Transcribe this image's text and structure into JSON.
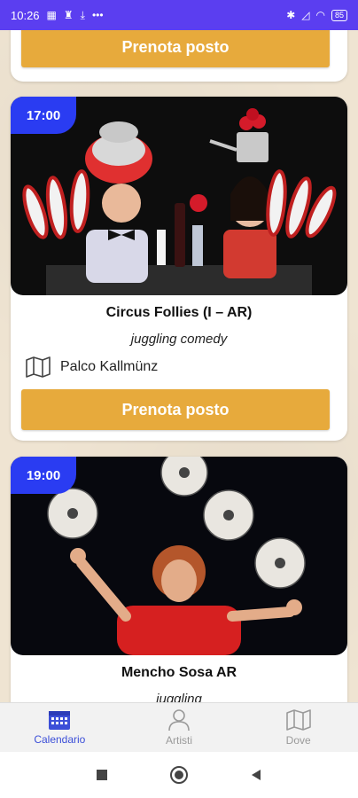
{
  "status_bar": {
    "time": "10:26",
    "battery": "85"
  },
  "cards": [
    {
      "book_label": "Prenota posto"
    },
    {
      "time": "17:00",
      "title": "Circus Follies (I – AR)",
      "subtitle": "juggling comedy",
      "venue": "Palco Kallmünz",
      "book_label": "Prenota posto"
    },
    {
      "time": "19:00",
      "title": "Mencho Sosa AR",
      "subtitle": "juggling"
    }
  ],
  "bottom_nav": [
    {
      "label": "Calendario",
      "icon": "calendar-icon",
      "active": true
    },
    {
      "label": "Artisti",
      "icon": "person-icon",
      "active": false
    },
    {
      "label": "Dove",
      "icon": "map-icon",
      "active": false
    }
  ],
  "colors": {
    "status_bar": "#5b3ef0",
    "book_button": "#e7aa3c",
    "time_badge": "#2a3cf2",
    "nav_active": "#3c4fd8"
  }
}
